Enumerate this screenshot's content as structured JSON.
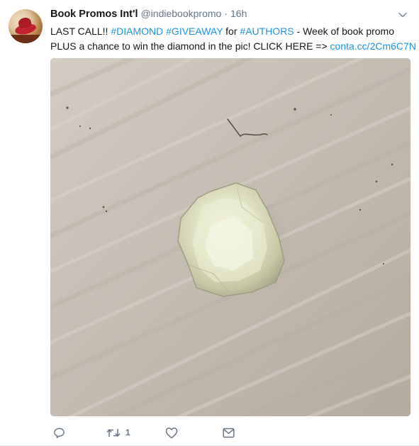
{
  "tweet": {
    "author_name": "Book Promos Int'l",
    "handle": "@indiebookpromo",
    "separator": "·",
    "time": "16h",
    "text_line1": [
      {
        "t": "LAST CALL!! ",
        "tag": false
      },
      {
        "t": "#DIAMOND",
        "tag": true
      },
      {
        "t": " ",
        "tag": false
      },
      {
        "t": "#GIVEAWAY",
        "tag": true
      },
      {
        "t": " for ",
        "tag": false
      },
      {
        "t": "#AUTHORS",
        "tag": true
      },
      {
        "t": " - Week of book promo",
        "tag": false
      }
    ],
    "text_line2": [
      {
        "t": "PLUS a chance to win the diamond in the pic! CLICK HERE => ",
        "tag": false
      },
      {
        "t": "conta.cc/2Cm6C7N",
        "tag": true
      }
    ],
    "retweet_count": "1",
    "colors": {
      "link": "#1b95e0",
      "muted": "#657786",
      "text": "#14171a"
    },
    "icons": {
      "more": "chevron-down-icon",
      "reply": "reply-icon",
      "retweet": "retweet-icon",
      "like": "heart-icon",
      "dm": "envelope-icon"
    }
  }
}
